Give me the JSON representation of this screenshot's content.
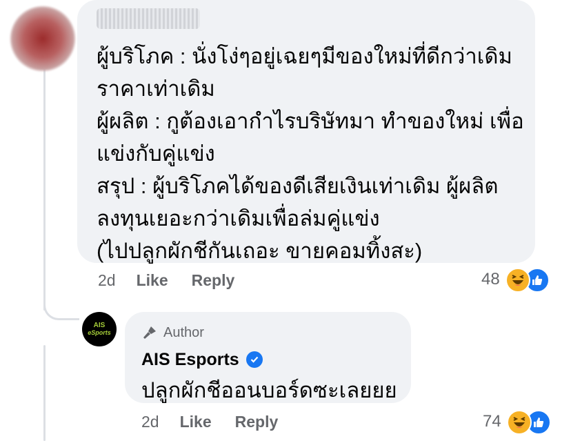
{
  "comment": {
    "lines": [
      "ผู้บริโภค : นั่งโง่ๆอยู่เฉยๆมีของใหม่ที่ดีกว่าเดิม",
      "ราคาเท่าเดิม",
      "ผู้ผลิต : กูต้องเอากำไรบริษัทมา ทำของใหม่ เพื่อ",
      "แข่งกับคู่แข่ง",
      "สรุป : ผู้บริโภคได้ของดีเสียเงินเท่าเดิม ผู้ผลิต",
      "ลงทุนเยอะกว่าเดิมเพื่อล่มคู่แข่ง",
      "(ไปปลูกผักชีกันเถอะ ขายคอมทิ้งสะ)"
    ],
    "time": "2d",
    "like_label": "Like",
    "reply_label": "Reply",
    "reaction_count": "48",
    "reaction_icons": [
      "haha-icon",
      "like-icon"
    ]
  },
  "reply": {
    "author_badge": "Author",
    "author_name": "AIS Esports",
    "avatar_text_top": "AIS",
    "avatar_text_bottom": "eSports",
    "text": "ปลูกผักชีออนบอร์ดซะเลยยย",
    "time": "2d",
    "like_label": "Like",
    "reply_label": "Reply",
    "reaction_count": "74",
    "reaction_icons": [
      "haha-icon",
      "like-icon"
    ]
  },
  "colors": {
    "bubble": "#f0f2f5",
    "meta_text": "#65676b",
    "like_blue": "#1877f2",
    "haha_yellow": "#f7b125"
  }
}
